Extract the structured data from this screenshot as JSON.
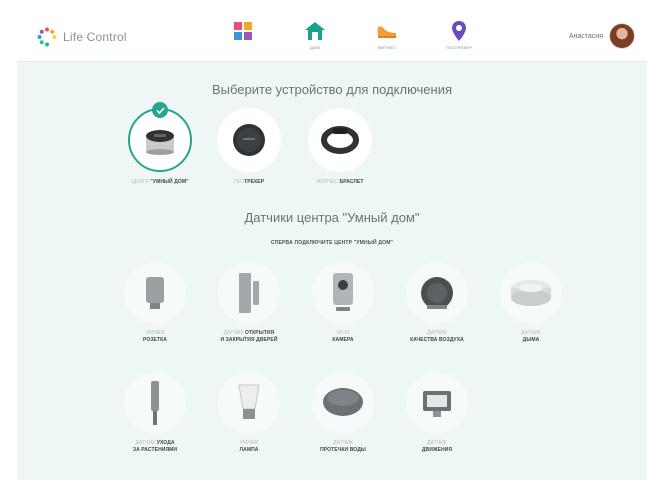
{
  "app": {
    "name": "Life Control"
  },
  "nav": [
    {
      "id": "apps",
      "icon": "grid-apps-icon",
      "label": ""
    },
    {
      "id": "home",
      "icon": "home-icon",
      "label": "ДОМ"
    },
    {
      "id": "fitness",
      "icon": "sneaker-icon",
      "label": "ФИТНЕС"
    },
    {
      "id": "geo",
      "icon": "location-pin-icon",
      "label": "ГЕОТРЕКЕР"
    }
  ],
  "user": {
    "name": "Анастасия"
  },
  "section1": {
    "title": "Выберите устройство для подключения",
    "devices": [
      {
        "light": "ЦЕНТР ",
        "bold": "\"УМНЫЙ ДОМ\"",
        "icon": "smart-home-hub-icon",
        "selected": true
      },
      {
        "light": "ГЕО",
        "bold": "ТРЕКЕР",
        "icon": "geotracker-icon",
        "selected": false
      },
      {
        "light": "ФИТНЕС ",
        "bold": "БРАСЛЕТ",
        "icon": "fitness-band-icon",
        "selected": false
      }
    ]
  },
  "section2": {
    "title": "Датчики центра \"Умный дом\"",
    "note": "СПЕРВА ПОДКЛЮЧИТЕ ЦЕНТР \"УМНЫЙ ДОМ\"",
    "sensors": [
      {
        "line1_light": "УМНАЯ",
        "line1_bold": "",
        "line2": "РОЗЕТКА",
        "icon": "smart-socket-icon"
      },
      {
        "line1_light": "ДАТЧИК ",
        "line1_bold": "ОТКРЫТИЯ",
        "line2": "И ЗАКРЫТИЯ ДВЕРЕЙ",
        "icon": "door-sensor-icon"
      },
      {
        "line1_light": "WI-FI",
        "line1_bold": "",
        "line2": "КАМЕРА",
        "icon": "wifi-camera-icon"
      },
      {
        "line1_light": "ДАТЧИК",
        "line1_bold": "",
        "line2": "КАЧЕСТВА ВОЗДУХА",
        "icon": "air-quality-sensor-icon"
      },
      {
        "line1_light": "ДАТЧИК",
        "line1_bold": "",
        "line2": "ДЫМА",
        "icon": "smoke-detector-icon"
      },
      {
        "line1_light": "ДАТЧИК ",
        "line1_bold": "УХОДА",
        "line2": "ЗА РАСТЕНИЯМИ",
        "icon": "plant-sensor-icon"
      },
      {
        "line1_light": "УМНАЯ",
        "line1_bold": "",
        "line2": "ЛАМПА",
        "icon": "smart-lamp-icon"
      },
      {
        "line1_light": "ДАТЧИК",
        "line1_bold": "",
        "line2": "ПРОТЕЧКИ ВОДЫ",
        "icon": "water-leak-sensor-icon"
      },
      {
        "line1_light": "ДАТЧИК",
        "line1_bold": "",
        "line2": "ДВИЖЕНИЯ",
        "icon": "motion-sensor-icon"
      }
    ]
  },
  "colors": {
    "accent": "#27a58d",
    "background": "#eef7f5",
    "text": "#6b7277"
  }
}
